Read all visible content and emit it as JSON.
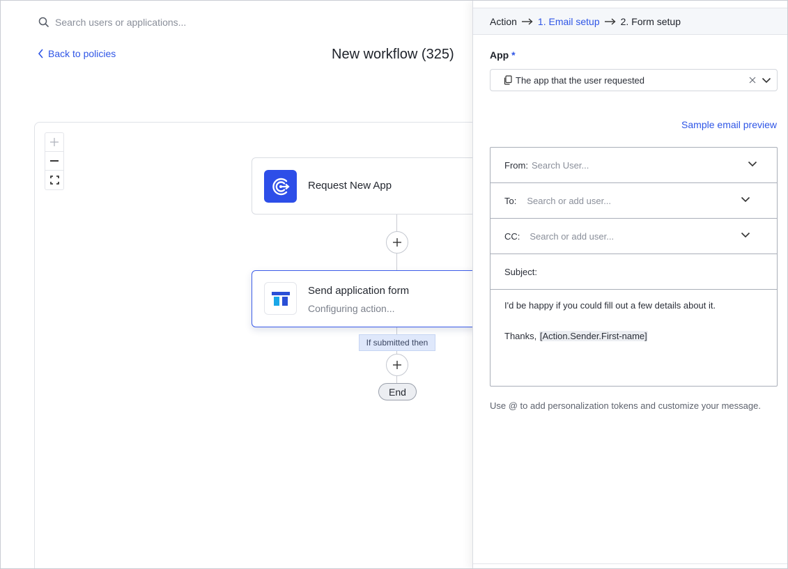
{
  "search": {
    "placeholder": "Search users or applications..."
  },
  "header": {
    "back_label": "Back to policies",
    "title": "New workflow (325)"
  },
  "canvas": {
    "zoom": {
      "in": "+",
      "out": "—",
      "fit": "fit-screen-icon"
    },
    "nodes": [
      {
        "title": "Request New App",
        "subtitle": "",
        "icon": "request-app-icon",
        "color": "#2d4ee8"
      },
      {
        "title": "Send application form",
        "subtitle": "Configuring action...",
        "icon": "form-app-icon",
        "color": "#2a4fd6"
      }
    ],
    "condition_label": "If submitted then",
    "end_label": "End"
  },
  "panel": {
    "breadcrumbs": [
      "Action",
      "1. Email setup",
      "2. Form setup"
    ],
    "app_field": {
      "label": "App",
      "required_mark": "*",
      "value": "The app that the user requested"
    },
    "preview_link": "Sample email preview",
    "email": {
      "from": {
        "label": "From:",
        "placeholder": "Search User..."
      },
      "to": {
        "label": "To:",
        "placeholder": "Search or add user..."
      },
      "cc": {
        "label": "CC:",
        "placeholder": "Search or add user..."
      },
      "subject": {
        "label": "Subject:"
      },
      "body_line1": "I'd be happy if you could fill out a few details about it.",
      "body_thanks": "Thanks,",
      "body_token": "[Action.Sender.First-name]"
    },
    "hint": "Use @ to add personalization tokens and customize your message."
  },
  "colors": {
    "accent": "#2e55e6",
    "border": "#a9aeb8",
    "breadcrumb_bg": "#f5f7fa"
  }
}
